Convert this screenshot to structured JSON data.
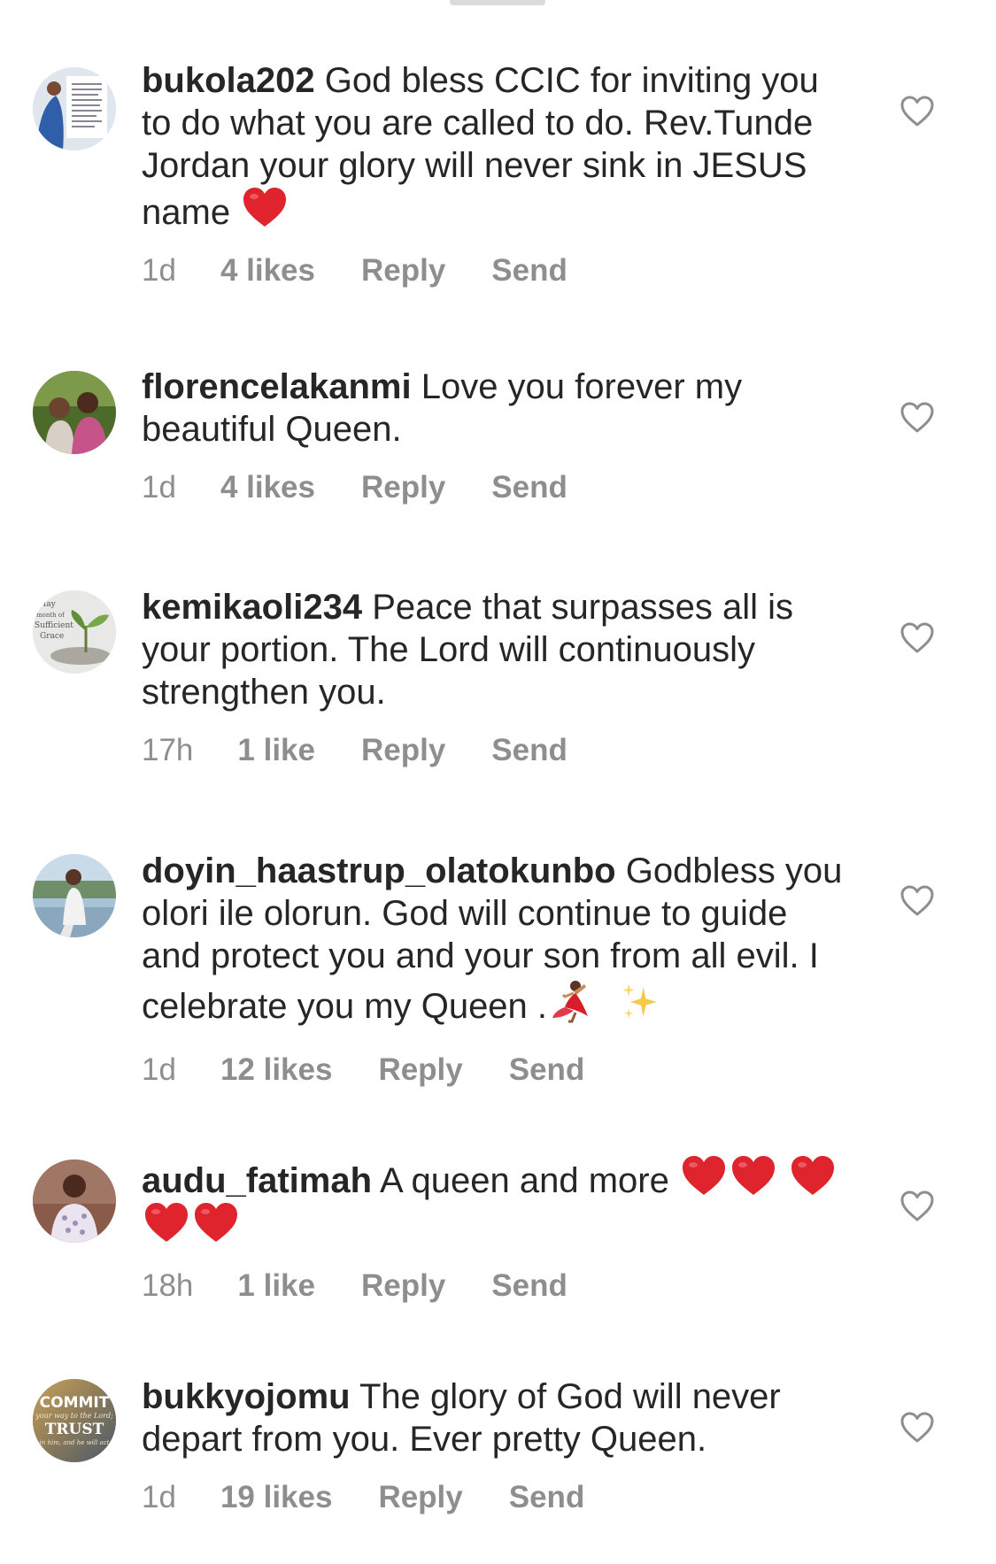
{
  "comments": [
    {
      "username": "bukola202",
      "text": "God bless CCIC for inviting you to do what you are  called to do. Rev.Tunde Jordan your glory will never sink in JESUS name",
      "emojis": [
        "red-heart"
      ],
      "age": "1d",
      "likes": "4 likes",
      "reply": "Reply",
      "send": "Send",
      "avatar_colors": [
        "#dfe6ee",
        "#2f5fa8"
      ]
    },
    {
      "username": "florencelakanmi",
      "text": "Love you forever my beautiful Queen.",
      "emojis": [],
      "age": "1d",
      "likes": "4 likes",
      "reply": "Reply",
      "send": "Send",
      "avatar_colors": [
        "#4c6a2a",
        "#c4548a"
      ]
    },
    {
      "username": "kemikaoli234",
      "text": "Peace that surpasses all is your portion. The Lord will continuously strengthen you.",
      "emojis": [],
      "age": "17h",
      "likes": "1 like",
      "reply": "Reply",
      "send": "Send",
      "avatar_colors": [
        "#e8e8e6",
        "#5f8f3a"
      ],
      "avatar_text": [
        "May",
        "month of",
        "Sufficient",
        "Grace"
      ]
    },
    {
      "username": "doyin_haastrup_olatokunbo",
      "text": "Godbless you olori ile olorun. God will continue to guide and protect you and your son from all evil. I celebrate you my Queen .",
      "emojis": [
        "dancer",
        "sparkles"
      ],
      "age": "1d",
      "likes": "12 likes",
      "reply": "Reply",
      "send": "Send",
      "avatar_colors": [
        "#a9c3d6",
        "#f2f2f2"
      ]
    },
    {
      "username": "audu_fatimah",
      "text": "A queen and more",
      "emojis": [
        "red-heart",
        "red-heart",
        "red-heart",
        "red-heart",
        "red-heart"
      ],
      "age": "18h",
      "likes": "1 like",
      "reply": "Reply",
      "send": "Send",
      "avatar_colors": [
        "#8a5a4a",
        "#e9e4f0"
      ]
    },
    {
      "username": "bukkyojomu",
      "text": "The glory of God will never depart from you. Ever pretty Queen.",
      "emojis": [],
      "age": "1d",
      "likes": "19 likes",
      "reply": "Reply",
      "send": "Send",
      "avatar_colors": [
        "#6d6a5c",
        "#c9a15a"
      ],
      "avatar_text": [
        "COMMIT",
        "your way to the Lord;",
        "TRUST",
        "in him, and he will act"
      ]
    }
  ],
  "colors": {
    "text": "#262626",
    "secondary": "#8e8e8e",
    "heart": "#e0242d",
    "divider": "#dbdbdb"
  }
}
